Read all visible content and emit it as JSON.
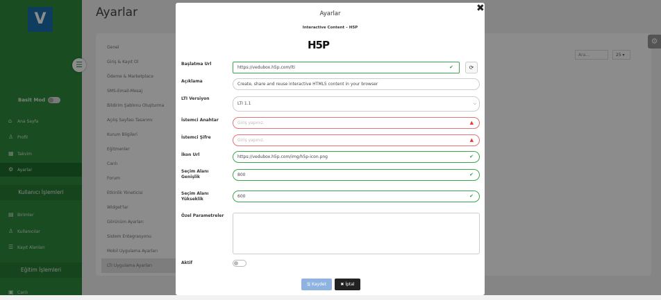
{
  "app": {
    "logo_letter": "V",
    "page_title": "Ayarlar",
    "mode_label": "Basit Mod",
    "brand_color": "#2e8b3c"
  },
  "sidebar": {
    "items": [
      {
        "label": "Ana Sayfa",
        "icon": "home-icon"
      },
      {
        "label": "Profil",
        "icon": "user-icon"
      },
      {
        "label": "Takvim",
        "icon": "calendar-icon"
      },
      {
        "label": "Ayarlar",
        "icon": "gear-icon",
        "active": true
      }
    ],
    "section1": "Kullanıcı İşlemleri",
    "items2": [
      {
        "label": "Birimler",
        "icon": "building-icon"
      },
      {
        "label": "Kullanıcılar",
        "icon": "users-icon"
      },
      {
        "label": "Kayıt Alanları",
        "icon": "list-icon"
      }
    ],
    "section2": "Eğitim İşlemleri",
    "items3": [
      {
        "label": "Canlı",
        "icon": "live-icon"
      }
    ]
  },
  "submenu": [
    "Genel",
    "Giriş & Kayıt Ol",
    "Ödeme & Marketplace",
    "SMS-Email-Mesaj",
    "Bildirim Şablonu Oluşturma",
    "Açılış Sayfası Tasarımı",
    "Kurum Bilgileri",
    "Eğitmenler",
    "Canlı",
    "Forum",
    "Etkinlik Yöneticisi",
    "Widget'lar",
    "Görünüm Ayarları",
    "Sistem Entegrasyonu",
    "Mobil Uygulama Ayarları",
    "LTI Uygulama Ayarları"
  ],
  "table_controls": {
    "search_placeholder": "Ara...",
    "page_size": "25 ▾"
  },
  "modal": {
    "title": "Ayarlar",
    "subtitle": "Interactive Content – H5P",
    "logo_text": "H5P",
    "fields": {
      "launch_url": {
        "label": "Başlatma Url",
        "value": "https://vedubox.h5p.com/lti"
      },
      "description": {
        "label": "Açıklama",
        "value": "Create, share and reuse interactive HTML5 content in your browser"
      },
      "lti_version": {
        "label": "LTI Versiyon",
        "value": "LTI 1.1"
      },
      "client_key": {
        "label": "İstemci Anahtar",
        "placeholder": "Giriş yapınız."
      },
      "client_secret": {
        "label": "İstemci Şifre",
        "placeholder": "Giriş yapınız."
      },
      "icon_url": {
        "label": "İkon Url",
        "value": "https://vedubox.h5p.com/img/h5p-icon.png"
      },
      "selection_width": {
        "label": "Seçim Alanı Genişlik",
        "value": "800"
      },
      "selection_height": {
        "label": "Seçim Alanı Yükseklik",
        "value": "600"
      },
      "custom_params": {
        "label": "Özel Parametreler",
        "value": ""
      },
      "active": {
        "label": "Aktif",
        "checked": false
      }
    },
    "save_label": "Kaydet",
    "cancel_label": "İptal"
  }
}
